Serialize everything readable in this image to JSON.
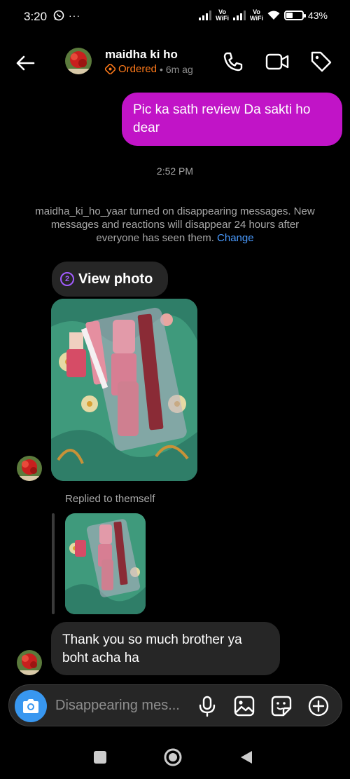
{
  "status_bar": {
    "time": "3:20",
    "more": "···",
    "volte1": "Vo\nWiFi",
    "volte2": "Vo\nWiFi",
    "battery_percent": "43%",
    "battery_level": 0.43,
    "icons": [
      "whatsapp-icon",
      "signal-icon",
      "wifi-icon",
      "battery-icon"
    ]
  },
  "header": {
    "name": "maidha ki ho",
    "status": "Ordered",
    "ago": "• 6m ag",
    "icons": [
      "back-arrow-icon",
      "phone-icon",
      "video-icon",
      "tag-icon"
    ]
  },
  "messages": {
    "outgoing_1": "Pic ka sath review Da sakti ho dear",
    "time_separator": "2:52 PM",
    "system_note": "maidha_ki_ho_yaar turned on disappearing messages. New messages and reactions will disappear 24 hours after everyone has seen them.",
    "system_link": "Change",
    "view_photo_count": "2",
    "view_photo_label": "View photo",
    "replied_label": "Replied to themself",
    "incoming_1": "Thank you so much brother ya boht acha ha"
  },
  "composer": {
    "placeholder": "Disappearing mes...",
    "icons": [
      "camera-icon",
      "microphone-icon",
      "gallery-icon",
      "sticker-icon",
      "plus-icon"
    ],
    "accent": "#3897f0"
  },
  "nav": {
    "icons": [
      "recents-icon",
      "home-icon",
      "back-icon"
    ]
  },
  "colors": {
    "outgoing_bubble": "#c114c7",
    "incoming_bubble": "#262626",
    "ordered": "#ff7a1a",
    "link": "#4a9bff"
  }
}
